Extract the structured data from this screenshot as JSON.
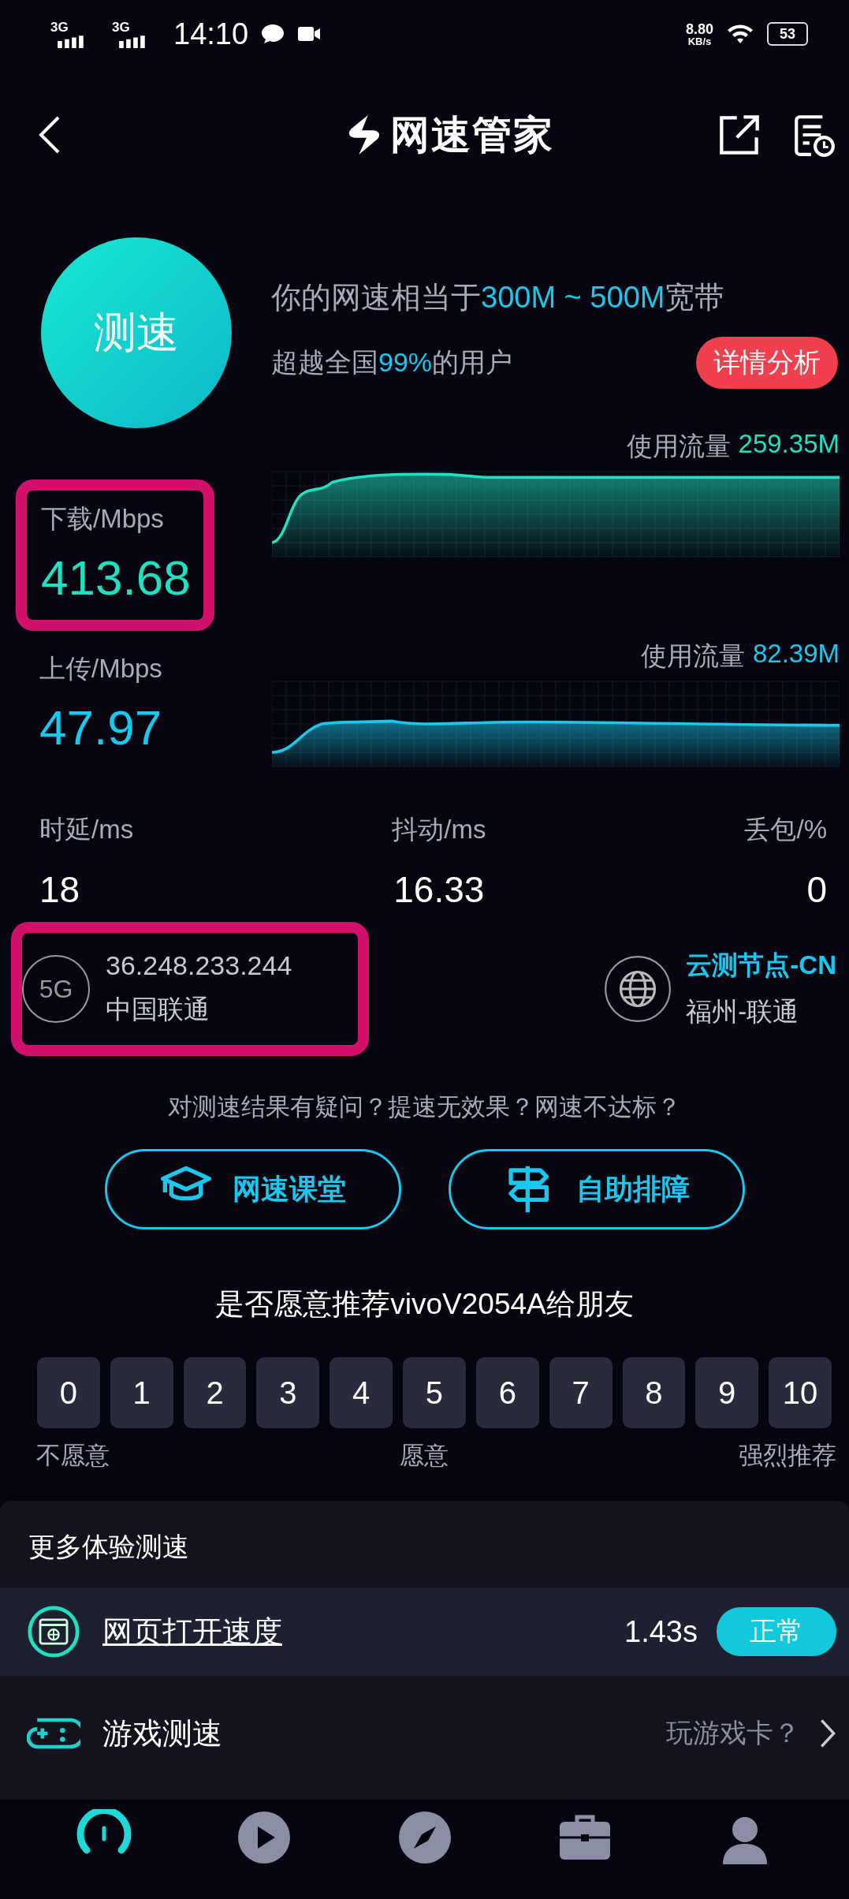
{
  "status_bar": {
    "signals": [
      {
        "label": "3G"
      },
      {
        "label": "3G"
      }
    ],
    "time": "14:10",
    "net_speed": "8.80",
    "net_unit": "KB/s",
    "battery": "53"
  },
  "header": {
    "title": "网速管家"
  },
  "summary": {
    "button": "测速",
    "line1": [
      {
        "text": "你的网速相当于",
        "accent": false
      },
      {
        "text": "300M ~ 500M",
        "accent": true
      },
      {
        "text": "宽带",
        "accent": false
      }
    ],
    "line2": [
      {
        "text": "超越全国",
        "accent": false
      },
      {
        "text": "99%",
        "accent": true
      },
      {
        "text": "的用户",
        "accent": false
      }
    ],
    "detail_button": "详情分析"
  },
  "speeds": [
    {
      "label": "下载/Mbps",
      "value": "413.68",
      "usage_label": "使用流量",
      "usage": "259.35M",
      "color": "#1fe0c0",
      "highlighted": true
    },
    {
      "label": "上传/Mbps",
      "value": "47.97",
      "usage_label": "使用流量",
      "usage": "82.39M",
      "color": "#18c8ee",
      "highlighted": false
    }
  ],
  "metrics": [
    {
      "label": "时延/ms",
      "value": "18"
    },
    {
      "label": "抖动/ms",
      "value": "16.33"
    },
    {
      "label": "丢包/%",
      "value": "0"
    }
  ],
  "network": {
    "badge": "5G",
    "ip": "36.248.233.244",
    "operator": "中国联通",
    "highlighted": true,
    "node": "云测节点-CN",
    "node_location": "福州-联通"
  },
  "help": {
    "question": "对测速结果有疑问？提速无效果？网速不达标？",
    "buttons": [
      {
        "kind": "class",
        "label": "网速课堂"
      },
      {
        "kind": "sign",
        "label": "自助排障"
      }
    ]
  },
  "recommend": {
    "title": "是否愿意推荐vivoV2054A给朋友",
    "scores": [
      "0",
      "1",
      "2",
      "3",
      "4",
      "5",
      "6",
      "7",
      "8",
      "9",
      "10"
    ],
    "scale": [
      "不愿意",
      "愿意",
      "强烈推荐"
    ]
  },
  "more": {
    "title": "更多体验测速",
    "items": [
      {
        "kind": "web",
        "label": "网页打开速度",
        "value": "1.43s",
        "status": "正常",
        "selected": true
      },
      {
        "kind": "game",
        "label": "游戏测速",
        "hint": "玩游戏卡？",
        "selected": false
      }
    ]
  },
  "nav": [
    {
      "kind": "gauge",
      "selected": true
    },
    {
      "kind": "play",
      "selected": false
    },
    {
      "kind": "compass",
      "selected": false
    },
    {
      "kind": "toolbox",
      "selected": false
    },
    {
      "kind": "person",
      "selected": false
    }
  ]
}
